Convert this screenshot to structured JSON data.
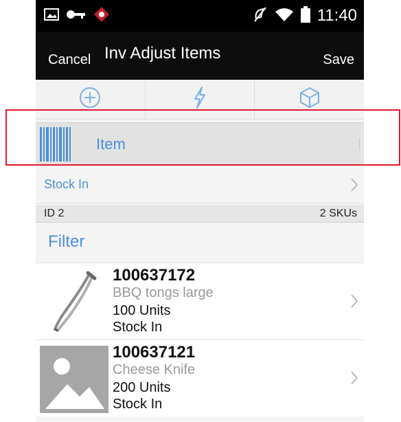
{
  "status_bar": {
    "time": "11:40",
    "icons": [
      "image-icon",
      "key-icon",
      "app-alert-icon",
      "mute-icon",
      "wifi-icon",
      "battery-icon"
    ]
  },
  "app_bar": {
    "cancel_label": "Cancel",
    "title": "Inv Adjust Items",
    "save_label": "Save"
  },
  "toolbar": {
    "icons": [
      "add-icon",
      "lightning-icon",
      "box-icon"
    ]
  },
  "scan": {
    "label": "Item",
    "icon": "barcode-icon"
  },
  "reason": {
    "label": "Stock In"
  },
  "summary": {
    "id_label": "ID 2",
    "sku_count": "2 SKUs"
  },
  "filter": {
    "label": "Filter"
  },
  "items": [
    {
      "id": "100637172",
      "description": "BBQ tongs large",
      "quantity": "100 Units",
      "type": "Stock In",
      "image": "tongs-image"
    },
    {
      "id": "100637121",
      "description": "Cheese Knife",
      "quantity": "200 Units",
      "type": "Stock In",
      "image": "placeholder-image"
    }
  ],
  "colors": {
    "accent": "#4a90d9",
    "highlight": "#e0182d",
    "header": "#0d0d0d"
  }
}
